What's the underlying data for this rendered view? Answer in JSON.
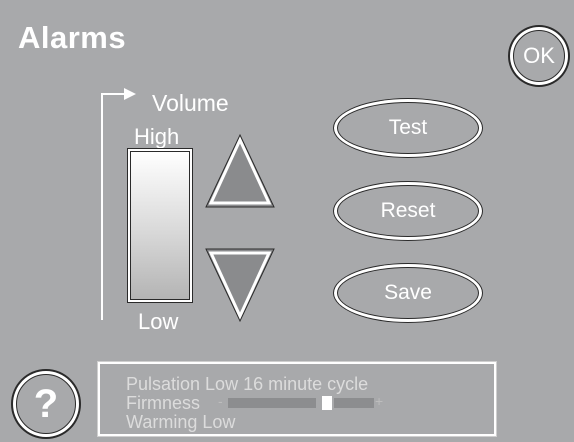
{
  "header": {
    "title": "Alarms",
    "ok_label": "OK"
  },
  "volume": {
    "label": "Volume",
    "high_label": "High",
    "low_label": "Low",
    "up_icon": "triangle-up-icon",
    "down_icon": "triangle-down-icon"
  },
  "actions": {
    "test_label": "Test",
    "reset_label": "Reset",
    "save_label": "Save"
  },
  "help": {
    "label": "?"
  },
  "status": {
    "pulsation": "Pulsation Low  16 minute cycle",
    "firmness_label": "Firmness",
    "firmness_minus": "-",
    "firmness_plus": "+",
    "firmness_level": 0.65,
    "warming": "Warming Low"
  },
  "colors": {
    "background": "#a8a9ab",
    "text": "#ffffff",
    "outline": "#2a2a2a"
  }
}
